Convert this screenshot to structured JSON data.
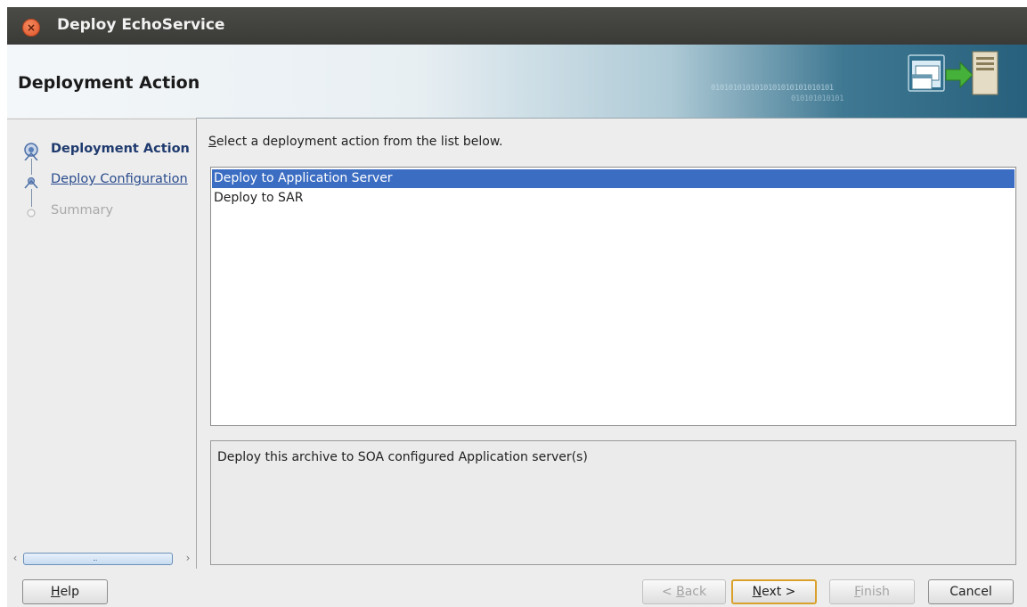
{
  "window": {
    "title": "Deploy EchoService"
  },
  "banner": {
    "title": "Deployment Action",
    "binary_a": "0101010101010101010101010101",
    "binary_b": "010101010101"
  },
  "steps": [
    {
      "label": "Deployment Action",
      "state": "current"
    },
    {
      "label": "Deploy Configuration",
      "state": "link"
    },
    {
      "label": "Summary",
      "state": "disabled"
    }
  ],
  "main": {
    "instruction_mnemonic": "S",
    "instruction_rest": "elect a deployment action from the list below.",
    "options": [
      {
        "label": "Deploy to Application Server",
        "selected": true
      },
      {
        "label": "Deploy to SAR",
        "selected": false
      }
    ],
    "description": "Deploy this archive to SOA configured Application server(s)"
  },
  "buttons": {
    "help": {
      "mnemonic": "H",
      "rest": "elp"
    },
    "back": {
      "prefix": "< ",
      "mnemonic": "B",
      "rest": "ack"
    },
    "next": {
      "mnemonic": "N",
      "rest": "ext >"
    },
    "finish": {
      "mnemonic": "F",
      "rest": "inish"
    },
    "cancel": "Cancel"
  },
  "colors": {
    "selection": "#3b6dc2",
    "titlebar": "#3e3e3b",
    "default_button_border": "#d9a12c"
  }
}
